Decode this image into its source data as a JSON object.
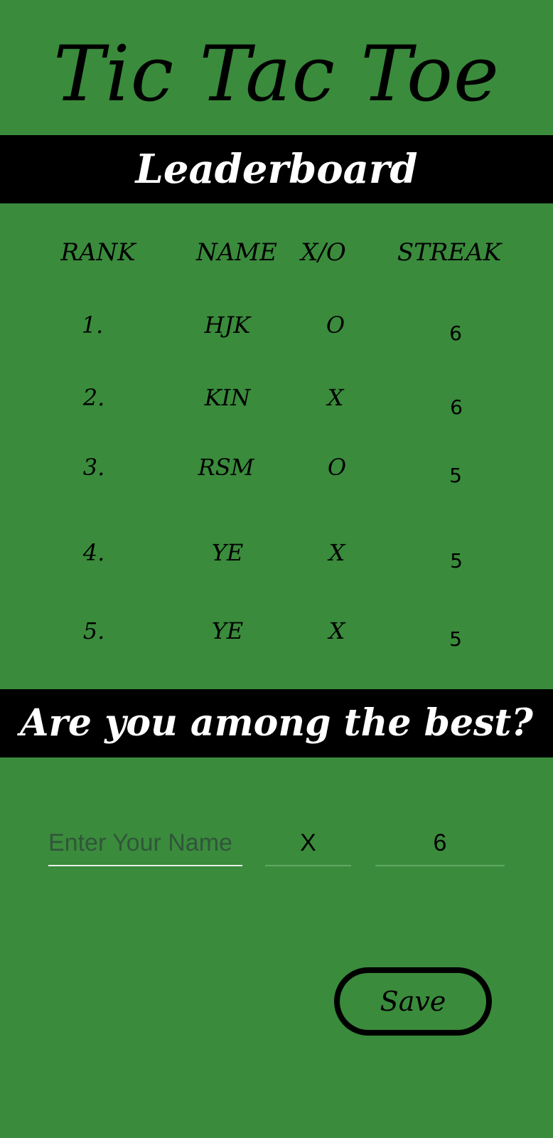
{
  "app": {
    "title": "Tic Tac Toe"
  },
  "leaderboard": {
    "heading": "Leaderboard",
    "columns": [
      "RANK",
      "NAME",
      "X/O",
      "STREAK"
    ],
    "rows": [
      {
        "rank": "1.",
        "name": "HJK",
        "xo": "O",
        "streak": "6"
      },
      {
        "rank": "2.",
        "name": "KIN",
        "xo": "X",
        "streak": "6"
      },
      {
        "rank": "3.",
        "name": "RSM",
        "xo": "O",
        "streak": "5"
      },
      {
        "rank": "4.",
        "name": "YE",
        "xo": "X",
        "streak": "5"
      },
      {
        "rank": "5.",
        "name": "YE",
        "xo": "X",
        "streak": "5"
      }
    ]
  },
  "entry": {
    "heading": "Are you among the best?",
    "name_placeholder": "Enter Your Name",
    "xo_value": "X",
    "streak_value": "6",
    "save_label": "Save"
  },
  "colors": {
    "background": "#3a8b3c",
    "band": "#000000",
    "band_text": "#ffffff"
  }
}
